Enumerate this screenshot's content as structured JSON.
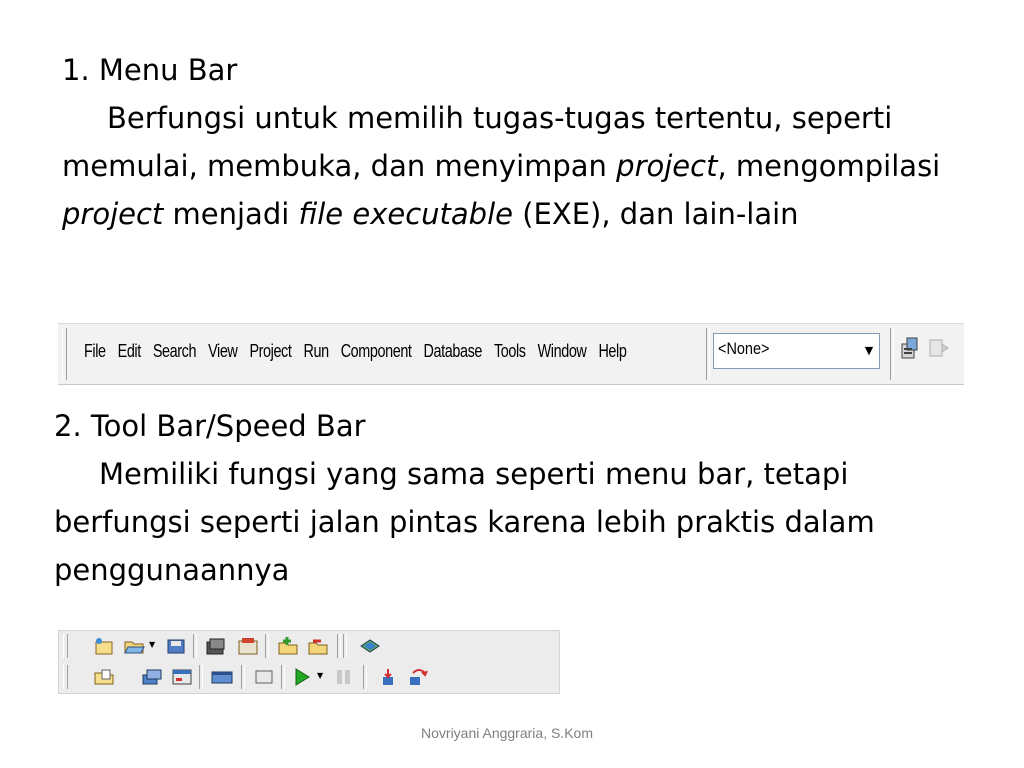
{
  "section1": {
    "heading": "1. Menu Bar",
    "text_1": "Berfungsi untuk memilih tugas-tugas tertentu, seperti memulai, membuka, dan menyimpan ",
    "em_1": "project",
    "text_2": ", mengompilasi ",
    "em_2": "project",
    "text_3": " menjadi ",
    "em_3": "file executable",
    "text_4": " (EXE), dan lain-lain"
  },
  "menubar": {
    "items": [
      "File",
      "Edit",
      "Search",
      "View",
      "Project",
      "Run",
      "Component",
      "Database",
      "Tools",
      "Window",
      "Help"
    ],
    "combo_value": "<None>"
  },
  "section2": {
    "heading": "2. Tool Bar/Speed Bar",
    "text": "Memiliki fungsi yang sama seperti menu bar, tetapi berfungsi seperti jalan pintas karena lebih praktis dalam penggunaannya"
  },
  "footer": "Novriyani Anggraria, S.Kom",
  "icons": {
    "menubar": [
      "set-configuration-icon",
      "open-configuration-icon"
    ],
    "toolbar_row1": [
      "new-items-icon",
      "open-icon",
      "save-icon",
      "save-all-icon",
      "open-project-icon",
      "add-file-to-project-icon",
      "remove-file-from-project-icon",
      "help-contents-icon"
    ],
    "toolbar_row2": [
      "open-file-icon",
      "view-unit-icon",
      "view-form-icon",
      "toggle-form-unit-icon",
      "new-form-icon",
      "run-icon",
      "pause-icon",
      "trace-into-icon",
      "step-over-icon"
    ]
  },
  "colors": {
    "background": "#ffffff",
    "text": "#000000",
    "footer": "#7f7f7f",
    "toolbar_bg": "#ececec"
  }
}
